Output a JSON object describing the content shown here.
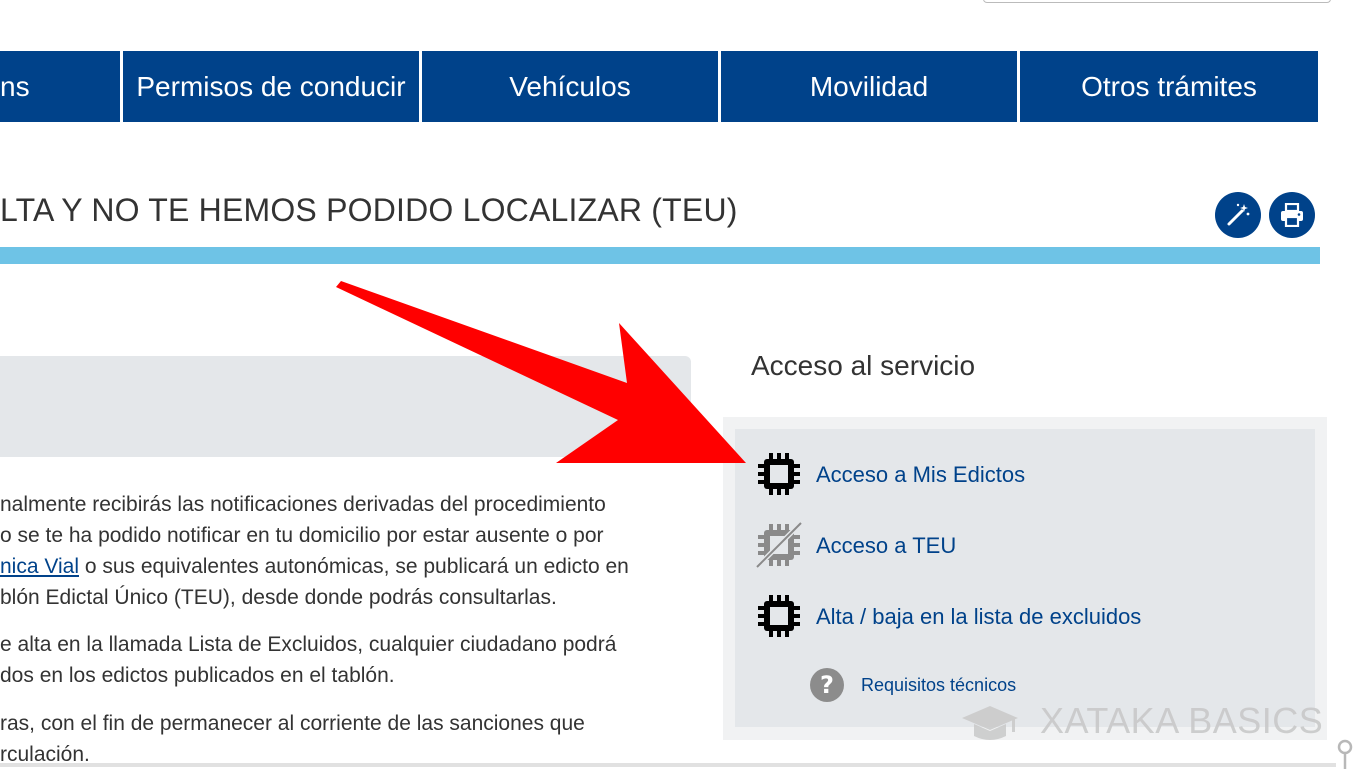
{
  "nav": {
    "items": [
      {
        "label": "ns"
      },
      {
        "label": "Permisos de conducir"
      },
      {
        "label": "Vehículos"
      },
      {
        "label": "Movilidad"
      },
      {
        "label": "Otros trámites"
      }
    ]
  },
  "page": {
    "title": "LTA Y NO TE HEMOS PODIDO LOCALIZAR (TEU)"
  },
  "tools": {
    "accessibility_icon": "magic-wand-icon",
    "print_icon": "print-icon"
  },
  "content": {
    "lines": [
      "nalmente recibirás las notificaciones derivadas del procedimiento",
      "o se te ha podido notificar en tu domicilio por estar ausente o por",
      {
        "link": "nica Vial",
        "rest": " o sus equivalentes autonómicas, se publicará un edicto en"
      },
      "blón Edictal Único (TEU), desde donde podrás consultarlas.",
      "e alta en la llamada Lista de Excluidos, cualquier ciudadano podrá",
      "dos en los edictos publicados en el tablón.",
      "ras, con el fin de permanecer al corriente de las sanciones que",
      "rculación."
    ]
  },
  "service": {
    "heading": "Acceso al servicio",
    "links": [
      {
        "label": "Acceso a Mis Edictos",
        "icon": "certificate-chip-icon"
      },
      {
        "label": "Acceso a TEU",
        "icon": "certificate-chip-disabled-icon"
      },
      {
        "label": "Alta / baja en la lista de excluidos",
        "icon": "certificate-chip-icon"
      }
    ],
    "help": {
      "label": "Requisitos técnicos",
      "icon": "help-icon"
    }
  },
  "watermark": {
    "text": "XATAKA BASICS"
  },
  "colors": {
    "nav_bg": "#00428a",
    "title_bar": "#6ec3e6",
    "panel_bg": "#e4e7ea",
    "link": "#00428a",
    "arrow": "#ff0000"
  }
}
